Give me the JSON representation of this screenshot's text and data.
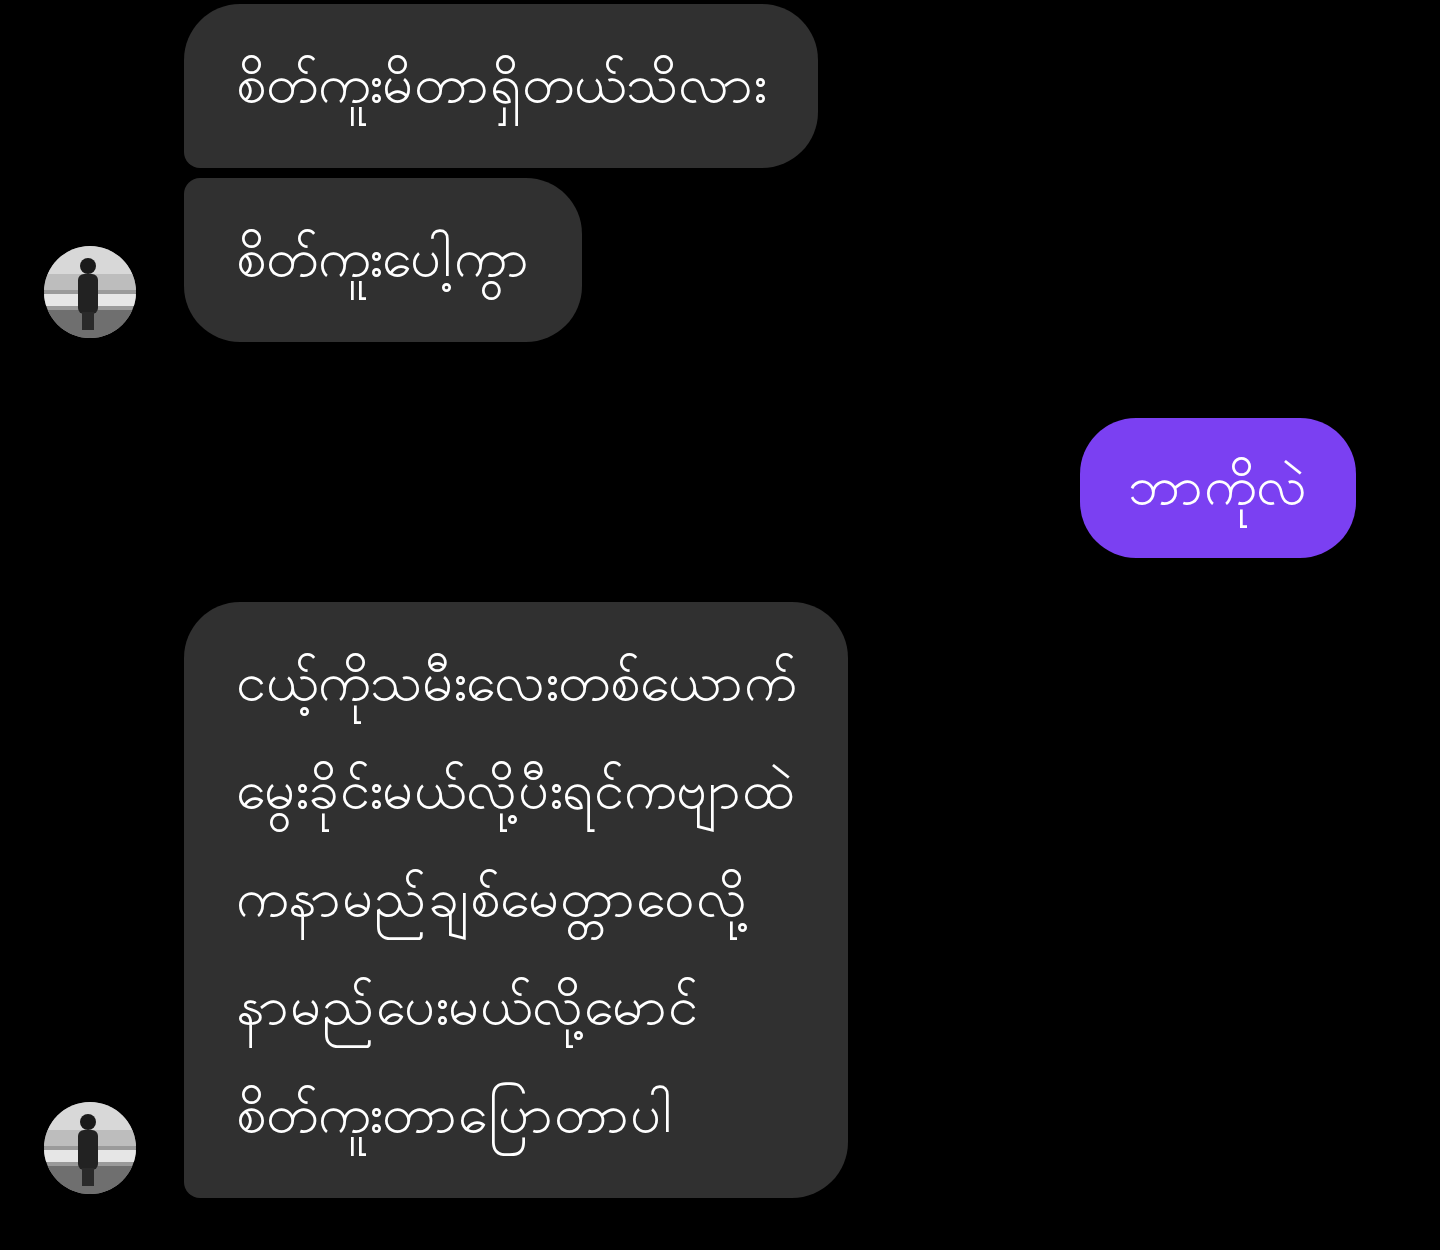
{
  "groups": [
    {
      "kind": "incoming",
      "messages": [
        "စိတ်ကူးမိတာရှိတယ်သိလား",
        "စိတ်ကူးပေါ့ကွာ"
      ]
    },
    {
      "kind": "outgoing",
      "messages": [
        "ဘာကိုလဲ"
      ]
    },
    {
      "kind": "incoming",
      "messages": [
        "ငယ့်ကိုသမီးလေးတစ်ယောက်\nမွေးခိုင်းမယ်လို့ပီးရင်ကဗျာထဲ\nကနာမည်ချစ်မေတ္တာဝေလို့\nနာမည်ပေးမယ်လို့မောင်\nစိတ်ကူးတာပြောတာပါ"
      ]
    }
  ]
}
